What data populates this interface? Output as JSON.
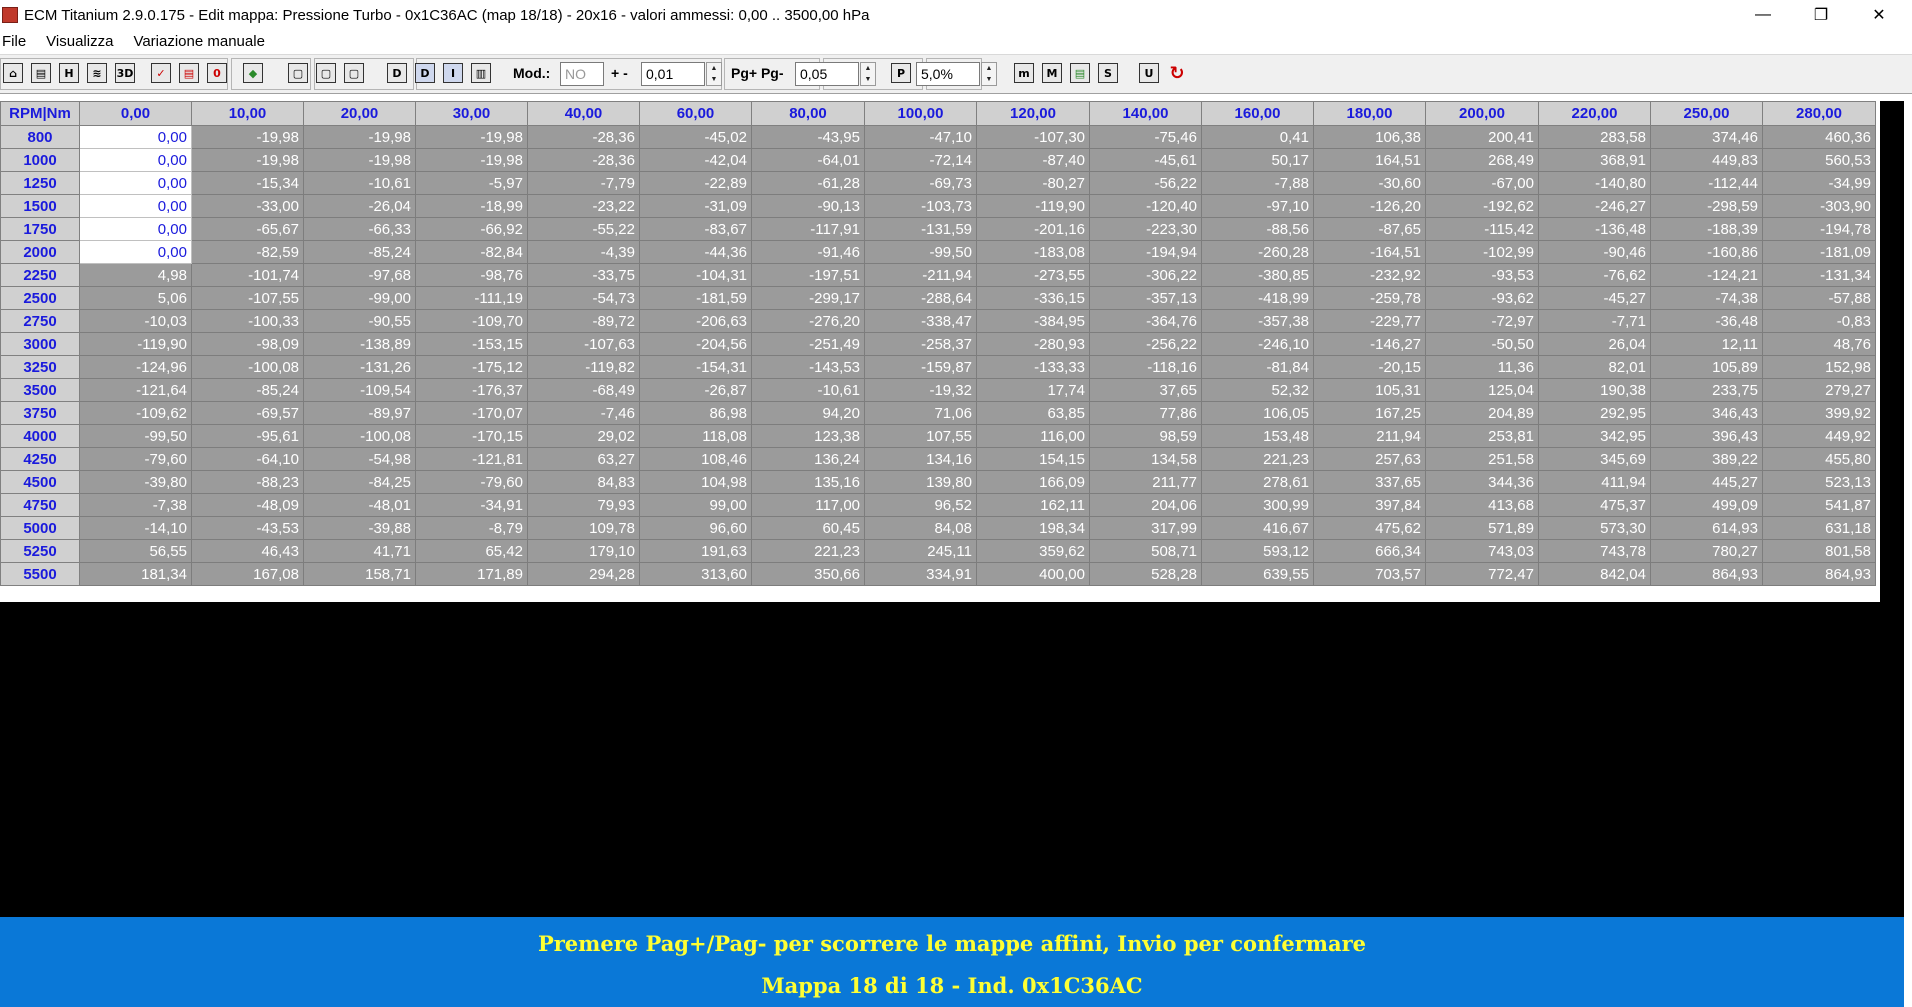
{
  "window": {
    "title": "ECM Titanium 2.9.0.175 - Edit mappa: Pressione Turbo - 0x1C36AC (map 18/18) - 20x16 - valori ammessi: 0,00 .. 3500,00 hPa",
    "minimize_glyph": "—",
    "restore_glyph": "❐",
    "close_glyph": "✕"
  },
  "menu": [
    "File",
    "Visualizza",
    "Variazione manuale"
  ],
  "toolbar": {
    "mod_label": "Mod.:",
    "mod_value": "NO",
    "step_label": "+ -",
    "step_value": "0,01",
    "page_label": "Pg+ Pg-",
    "page_value": "0,05",
    "percent_value": "5,0%",
    "icon_glyphs": [
      "⌂",
      "▤",
      "H",
      "≋",
      "3D",
      "✓",
      "▤",
      "0",
      "◆",
      "▢",
      "▢",
      "▢",
      "D",
      "D",
      "I",
      "▥",
      "P",
      "m",
      "M",
      "▤",
      "S",
      "U",
      "↻"
    ]
  },
  "table": {
    "corner": "RPM|Nm",
    "columns": [
      "0,00",
      "10,00",
      "20,00",
      "30,00",
      "40,00",
      "60,00",
      "80,00",
      "100,00",
      "120,00",
      "140,00",
      "160,00",
      "180,00",
      "200,00",
      "220,00",
      "250,00",
      "280,00"
    ],
    "rows": [
      {
        "rpm": "800",
        "v": [
          "0,00",
          "-19,98",
          "-19,98",
          "-19,98",
          "-28,36",
          "-45,02",
          "-43,95",
          "-47,10",
          "-107,30",
          "-75,46",
          "0,41",
          "106,38",
          "200,41",
          "283,58",
          "374,46",
          "460,36"
        ]
      },
      {
        "rpm": "1000",
        "v": [
          "0,00",
          "-19,98",
          "-19,98",
          "-19,98",
          "-28,36",
          "-42,04",
          "-64,01",
          "-72,14",
          "-87,40",
          "-45,61",
          "50,17",
          "164,51",
          "268,49",
          "368,91",
          "449,83",
          "560,53"
        ]
      },
      {
        "rpm": "1250",
        "v": [
          "0,00",
          "-15,34",
          "-10,61",
          "-5,97",
          "-7,79",
          "-22,89",
          "-61,28",
          "-69,73",
          "-80,27",
          "-56,22",
          "-7,88",
          "-30,60",
          "-67,00",
          "-140,80",
          "-112,44",
          "-34,99"
        ]
      },
      {
        "rpm": "1500",
        "v": [
          "0,00",
          "-33,00",
          "-26,04",
          "-18,99",
          "-23,22",
          "-31,09",
          "-90,13",
          "-103,73",
          "-119,90",
          "-120,40",
          "-97,10",
          "-126,20",
          "-192,62",
          "-246,27",
          "-298,59",
          "-303,90"
        ]
      },
      {
        "rpm": "1750",
        "v": [
          "0,00",
          "-65,67",
          "-66,33",
          "-66,92",
          "-55,22",
          "-83,67",
          "-117,91",
          "-131,59",
          "-201,16",
          "-223,30",
          "-88,56",
          "-87,65",
          "-115,42",
          "-136,48",
          "-188,39",
          "-194,78"
        ]
      },
      {
        "rpm": "2000",
        "v": [
          "0,00",
          "-82,59",
          "-85,24",
          "-82,84",
          "-4,39",
          "-44,36",
          "-91,46",
          "-99,50",
          "-183,08",
          "-194,94",
          "-260,28",
          "-164,51",
          "-102,99",
          "-90,46",
          "-160,86",
          "-181,09"
        ]
      },
      {
        "rpm": "2250",
        "v": [
          "4,98",
          "-101,74",
          "-97,68",
          "-98,76",
          "-33,75",
          "-104,31",
          "-197,51",
          "-211,94",
          "-273,55",
          "-306,22",
          "-380,85",
          "-232,92",
          "-93,53",
          "-76,62",
          "-124,21",
          "-131,34"
        ]
      },
      {
        "rpm": "2500",
        "v": [
          "5,06",
          "-107,55",
          "-99,00",
          "-111,19",
          "-54,73",
          "-181,59",
          "-299,17",
          "-288,64",
          "-336,15",
          "-357,13",
          "-418,99",
          "-259,78",
          "-93,62",
          "-45,27",
          "-74,38",
          "-57,88"
        ]
      },
      {
        "rpm": "2750",
        "v": [
          "-10,03",
          "-100,33",
          "-90,55",
          "-109,70",
          "-89,72",
          "-206,63",
          "-276,20",
          "-338,47",
          "-384,95",
          "-364,76",
          "-357,38",
          "-229,77",
          "-72,97",
          "-7,71",
          "-36,48",
          "-0,83"
        ]
      },
      {
        "rpm": "3000",
        "v": [
          "-119,90",
          "-98,09",
          "-138,89",
          "-153,15",
          "-107,63",
          "-204,56",
          "-251,49",
          "-258,37",
          "-280,93",
          "-256,22",
          "-246,10",
          "-146,27",
          "-50,50",
          "26,04",
          "12,11",
          "48,76"
        ]
      },
      {
        "rpm": "3250",
        "v": [
          "-124,96",
          "-100,08",
          "-131,26",
          "-175,12",
          "-119,82",
          "-154,31",
          "-143,53",
          "-159,87",
          "-133,33",
          "-118,16",
          "-81,84",
          "-20,15",
          "11,36",
          "82,01",
          "105,89",
          "152,98"
        ]
      },
      {
        "rpm": "3500",
        "v": [
          "-121,64",
          "-85,24",
          "-109,54",
          "-176,37",
          "-68,49",
          "-26,87",
          "-10,61",
          "-19,32",
          "17,74",
          "37,65",
          "52,32",
          "105,31",
          "125,04",
          "190,38",
          "233,75",
          "279,27"
        ]
      },
      {
        "rpm": "3750",
        "v": [
          "-109,62",
          "-69,57",
          "-89,97",
          "-170,07",
          "-7,46",
          "86,98",
          "94,20",
          "71,06",
          "63,85",
          "77,86",
          "106,05",
          "167,25",
          "204,89",
          "292,95",
          "346,43",
          "399,92"
        ]
      },
      {
        "rpm": "4000",
        "v": [
          "-99,50",
          "-95,61",
          "-100,08",
          "-170,15",
          "29,02",
          "118,08",
          "123,38",
          "107,55",
          "116,00",
          "98,59",
          "153,48",
          "211,94",
          "253,81",
          "342,95",
          "396,43",
          "449,92"
        ]
      },
      {
        "rpm": "4250",
        "v": [
          "-79,60",
          "-64,10",
          "-54,98",
          "-121,81",
          "63,27",
          "108,46",
          "136,24",
          "134,16",
          "154,15",
          "134,58",
          "221,23",
          "257,63",
          "251,58",
          "345,69",
          "389,22",
          "455,80"
        ]
      },
      {
        "rpm": "4500",
        "v": [
          "-39,80",
          "-88,23",
          "-84,25",
          "-79,60",
          "84,83",
          "104,98",
          "135,16",
          "139,80",
          "166,09",
          "211,77",
          "278,61",
          "337,65",
          "344,36",
          "411,94",
          "445,27",
          "523,13"
        ]
      },
      {
        "rpm": "4750",
        "v": [
          "-7,38",
          "-48,09",
          "-48,01",
          "-34,91",
          "79,93",
          "99,00",
          "117,00",
          "96,52",
          "162,11",
          "204,06",
          "300,99",
          "397,84",
          "413,68",
          "475,37",
          "499,09",
          "541,87"
        ]
      },
      {
        "rpm": "5000",
        "v": [
          "-14,10",
          "-43,53",
          "-39,88",
          "-8,79",
          "109,78",
          "96,60",
          "60,45",
          "84,08",
          "198,34",
          "317,99",
          "416,67",
          "475,62",
          "571,89",
          "573,30",
          "614,93",
          "631,18"
        ]
      },
      {
        "rpm": "5250",
        "v": [
          "56,55",
          "46,43",
          "41,71",
          "65,42",
          "179,10",
          "191,63",
          "221,23",
          "245,11",
          "359,62",
          "508,71",
          "593,12",
          "666,34",
          "743,03",
          "743,78",
          "780,27",
          "801,58"
        ]
      },
      {
        "rpm": "5500",
        "v": [
          "181,34",
          "167,08",
          "158,71",
          "171,89",
          "294,28",
          "313,60",
          "350,66",
          "334,91",
          "400,00",
          "528,28",
          "639,55",
          "703,57",
          "772,47",
          "842,04",
          "864,93",
          "864,93"
        ]
      }
    ]
  },
  "status": {
    "line1": "Premere Pag+/Pag- per scorrere le mappe affini, Invio per confermare",
    "line2": "Mappa 18 di 18 - Ind. 0x1C36AC"
  },
  "colors": {
    "cell_bg": "#9b9b9b",
    "header_text": "#1a1adc",
    "status_bg": "#0a78d7",
    "status_text": "#ffff33"
  }
}
